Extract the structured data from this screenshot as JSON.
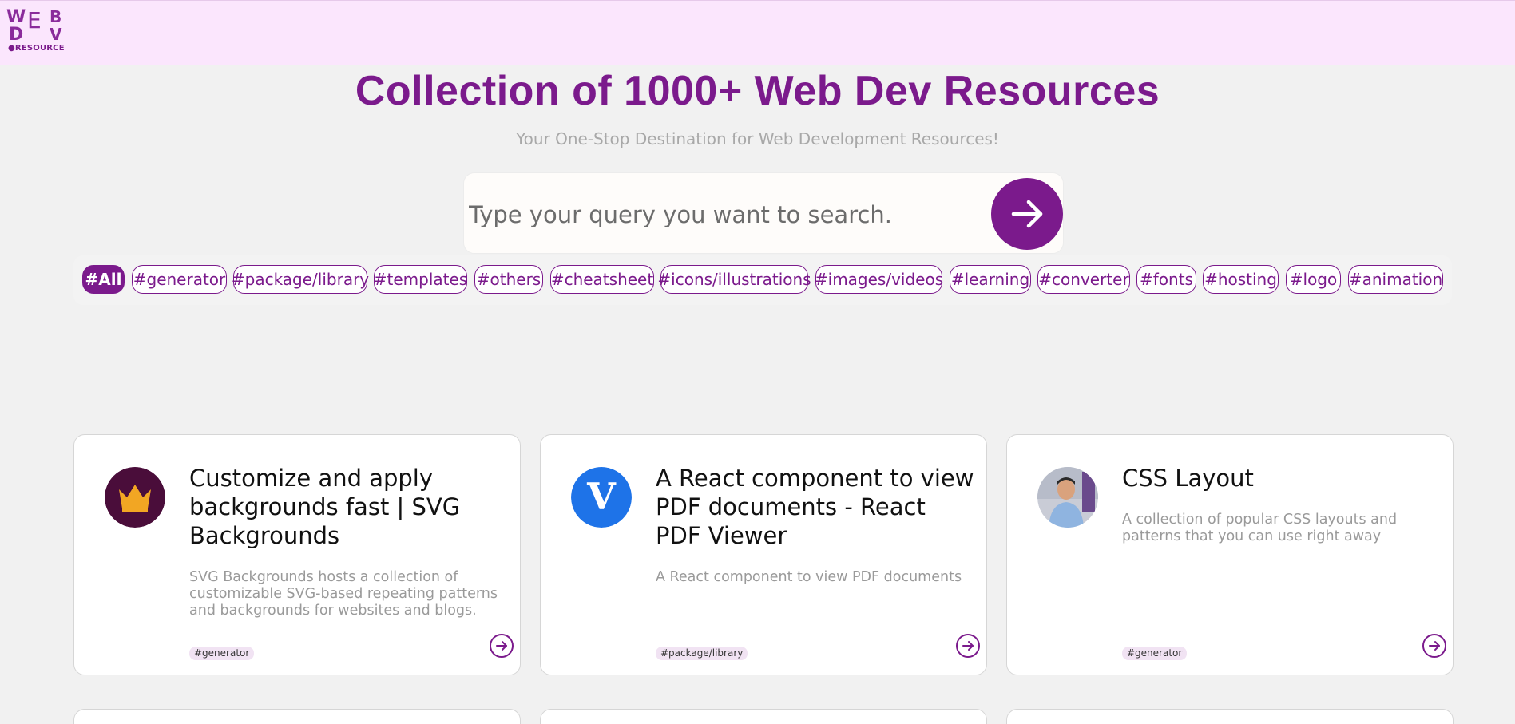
{
  "brand": {
    "logo_text": "WEB DEV",
    "logo_sub": "●RESOURCE",
    "accent": "#7b1a8c",
    "topbar_color": "#fbe6fd"
  },
  "hero": {
    "title": "Collection of 1000+ Web Dev Resources",
    "subtitle": "Your One-Stop Destination for Web Development Resources!"
  },
  "search": {
    "placeholder": "Type your query you want to search.",
    "button_icon": "arrow-right-icon"
  },
  "filters": [
    {
      "label": "#All",
      "active": true
    },
    {
      "label": "#generator"
    },
    {
      "label": "#package/library"
    },
    {
      "label": "#templates"
    },
    {
      "label": "#others"
    },
    {
      "label": "#cheatsheet"
    },
    {
      "label": "#icons/illustrations"
    },
    {
      "label": "#images/videos"
    },
    {
      "label": "#learning"
    },
    {
      "label": "#converter"
    },
    {
      "label": "#fonts"
    },
    {
      "label": "#hosting"
    },
    {
      "label": "#logo"
    },
    {
      "label": "#animation"
    }
  ],
  "cards": [
    {
      "title": "Customize and apply backgrounds fast | SVG Backgrounds",
      "description": "SVG Backgrounds hosts a collection of customizable SVG-based repeating patterns and backgrounds for websites and blogs.",
      "tag": "#generator",
      "icon": "crown-icon"
    },
    {
      "title": "A React component to view PDF documents - React PDF Viewer",
      "description": "A React component to view PDF documents",
      "tag": "#package/library",
      "icon": "v-logo-icon"
    },
    {
      "title": "CSS Layout",
      "description": "A collection of popular CSS layouts and patterns that you can use right away",
      "tag": "#generator",
      "icon": "person-photo"
    }
  ]
}
